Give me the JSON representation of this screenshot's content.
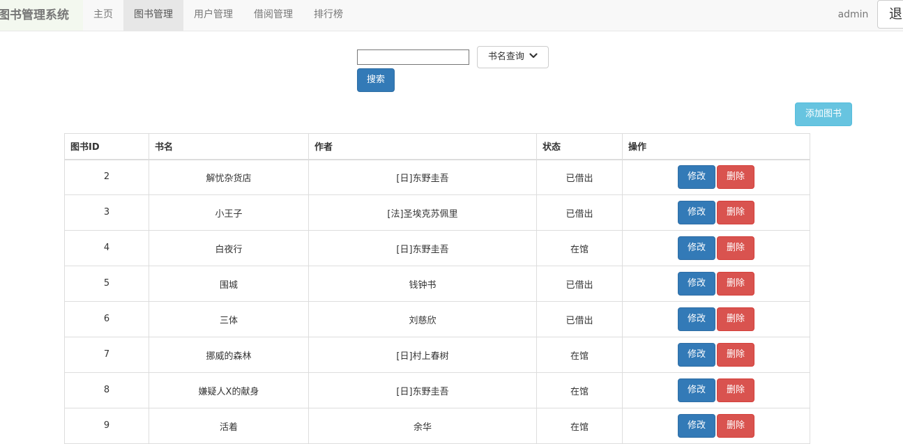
{
  "navbar": {
    "brand": "图书管理系统",
    "items": [
      {
        "label": "主页"
      },
      {
        "label": "图书管理"
      },
      {
        "label": "用户管理"
      },
      {
        "label": "借阅管理"
      },
      {
        "label": "排行榜"
      }
    ],
    "active_item": "图书管理",
    "username": "admin",
    "logout_label": "退出"
  },
  "search": {
    "input_value": "",
    "type_label": "书名查询",
    "button_label": "搜索"
  },
  "add_book_label": "添加图书",
  "table": {
    "headers": [
      "图书ID",
      "书名",
      "作者",
      "状态",
      "操作"
    ],
    "edit_label": "修改",
    "delete_label": "删除",
    "rows": [
      {
        "id": "2",
        "name": "解忧杂货店",
        "author": "[日]东野圭吾",
        "status": "已借出"
      },
      {
        "id": "3",
        "name": "小王子",
        "author": "[法]圣埃克苏佩里",
        "status": "已借出"
      },
      {
        "id": "4",
        "name": "白夜行",
        "author": "[日]东野圭吾",
        "status": "在馆"
      },
      {
        "id": "5",
        "name": "围城",
        "author": "钱钟书",
        "status": "已借出"
      },
      {
        "id": "6",
        "name": "三体",
        "author": "刘慈欣",
        "status": "已借出"
      },
      {
        "id": "7",
        "name": "挪威的森林",
        "author": "[日]村上春树",
        "status": "在馆"
      },
      {
        "id": "8",
        "name": "嫌疑人X的献身",
        "author": "[日]东野圭吾",
        "status": "在馆"
      },
      {
        "id": "9",
        "name": "活着",
        "author": "余华",
        "status": "在馆"
      }
    ]
  }
}
